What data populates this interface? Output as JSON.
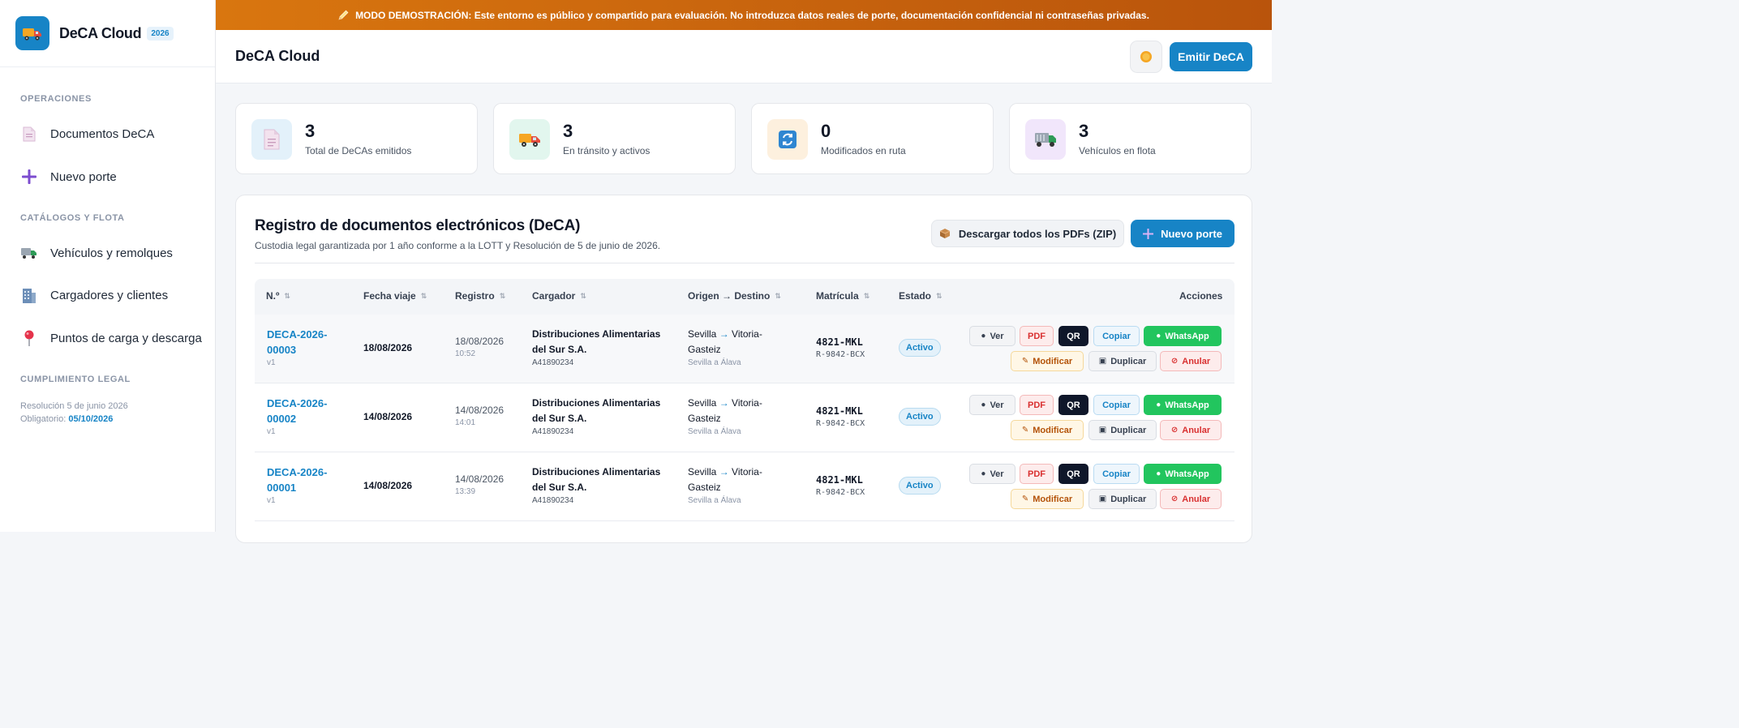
{
  "brand": {
    "name": "DeCA Cloud",
    "year": "2026"
  },
  "sidebar": {
    "sections": [
      {
        "title": "OPERACIONES",
        "items": [
          {
            "label": "Documentos DeCA",
            "icon": "document-icon"
          },
          {
            "label": "Nuevo porte",
            "icon": "plus-icon"
          }
        ]
      },
      {
        "title": "CATÁLOGOS Y FLOTA",
        "items": [
          {
            "label": "Vehículos y remolques",
            "icon": "truck-icon"
          },
          {
            "label": "Cargadores y clientes",
            "icon": "building-icon"
          },
          {
            "label": "Puntos de carga y descarga",
            "icon": "pin-icon"
          }
        ]
      },
      {
        "title": "CUMPLIMIENTO LEGAL",
        "items": []
      }
    ],
    "legal": {
      "line1": "Resolución 5 de junio 2026",
      "line2_prefix": "Obligatorio:",
      "line2_date": "05/10/2026"
    }
  },
  "banner": {
    "strong": "MODO DEMOSTRACIÓN:",
    "text": "Este entorno es público y compartido para evaluación. No introduzca datos reales de porte, documentación confidencial ni contraseñas privadas."
  },
  "header": {
    "title": "DeCA Cloud",
    "emit_label": "Emitir DeCA"
  },
  "stats": [
    {
      "value": "3",
      "label": "Total de DeCAs emitidos",
      "icon": "document-icon",
      "bg": "#e3f1fa"
    },
    {
      "value": "3",
      "label": "En tránsito y activos",
      "icon": "truck-icon",
      "bg": "#e2f6ee"
    },
    {
      "value": "0",
      "label": "Modificados en ruta",
      "icon": "refresh-icon",
      "bg": "#fdf0de"
    },
    {
      "value": "3",
      "label": "Vehículos en flota",
      "icon": "lorry-icon",
      "bg": "#f1e6fb"
    }
  ],
  "register": {
    "title": "Registro de documentos electrónicos (DeCA)",
    "subtitle": "Custodia legal garantizada por 1 año conforme a la LOTT y Resolución de 5 de junio de 2026.",
    "zip_label": "Descargar todos los PDFs (ZIP)",
    "new_label": "Nuevo porte",
    "columns": [
      "N.º",
      "Fecha viaje",
      "Registro",
      "Cargador",
      "Origen → Destino",
      "Matrícula",
      "Estado",
      "Acciones"
    ],
    "actions": {
      "ver": "Ver",
      "pdf": "PDF",
      "qr": "QR",
      "copiar": "Copiar",
      "whatsapp": "WhatsApp",
      "modificar": "Modificar",
      "duplicar": "Duplicar",
      "anular": "Anular"
    },
    "rows": [
      {
        "num1": "DECA-2026-",
        "num2": "00003",
        "version": "v1",
        "fecha": "18/08/2026",
        "reg_date": "18/08/2026",
        "reg_time": "10:52",
        "cargador1": "Distribuciones Alimentarias",
        "cargador2": "del Sur S.A.",
        "cif": "A41890234",
        "origen": "Sevilla",
        "destino1": "Vitoria-",
        "destino2": "Gasteiz",
        "ruta_sub": "Sevilla a Álava",
        "matricula": "4821-MKL",
        "remolque": "R-9842-BCX",
        "estado": "Activo"
      },
      {
        "num1": "DECA-2026-",
        "num2": "00002",
        "version": "v1",
        "fecha": "14/08/2026",
        "reg_date": "14/08/2026",
        "reg_time": "14:01",
        "cargador1": "Distribuciones Alimentarias",
        "cargador2": "del Sur S.A.",
        "cif": "A41890234",
        "origen": "Sevilla",
        "destino1": "Vitoria-",
        "destino2": "Gasteiz",
        "ruta_sub": "Sevilla a Álava",
        "matricula": "4821-MKL",
        "remolque": "R-9842-BCX",
        "estado": "Activo"
      },
      {
        "num1": "DECA-2026-",
        "num2": "00001",
        "version": "v1",
        "fecha": "14/08/2026",
        "reg_date": "14/08/2026",
        "reg_time": "13:39",
        "cargador1": "Distribuciones Alimentarias",
        "cargador2": "del Sur S.A.",
        "cif": "A41890234",
        "origen": "Sevilla",
        "destino1": "Vitoria-",
        "destino2": "Gasteiz",
        "ruta_sub": "Sevilla a Álava",
        "matricula": "4821-MKL",
        "remolque": "R-9842-BCX",
        "estado": "Activo"
      }
    ]
  },
  "colors": {
    "accent": "#1784c6",
    "banner": "#d9760f",
    "whatsapp": "#22c55e",
    "danger": "#d93030",
    "warning": "#b45309"
  }
}
